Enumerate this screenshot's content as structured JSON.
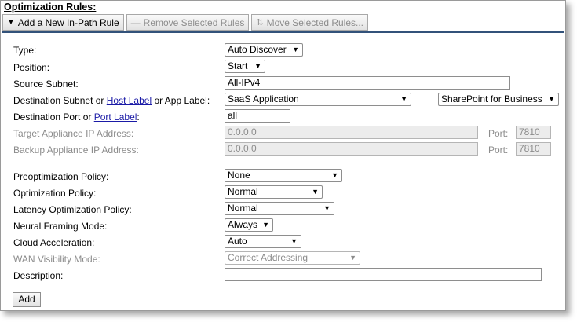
{
  "title": "Optimization Rules:",
  "toolbar": {
    "add_icon": "triangle-down-icon",
    "add_label": "Add a New In-Path Rule",
    "remove_icon": "minus-icon",
    "remove_label": "Remove Selected Rules",
    "move_icon": "move-arrows-icon",
    "move_label": "Move Selected Rules..."
  },
  "form": {
    "type_label": "Type:",
    "type_value": "Auto Discover",
    "position_label": "Position:",
    "position_value": "Start",
    "source_label": "Source Subnet:",
    "source_value": "All-IPv4",
    "dest_prefix": "Destination Subnet or ",
    "dest_link1": "Host Label",
    "dest_middle": " or App Label:",
    "dest_value": "SaaS Application",
    "dest_app_value": "SharePoint for Business",
    "port_prefix": "Destination Port or ",
    "port_link": "Port Label",
    "port_suffix": ":",
    "port_value": "all",
    "target_label": "Target Appliance IP Address:",
    "target_ip": "0.0.0.0",
    "target_port_label": "Port:",
    "target_port": "7810",
    "backup_label": "Backup Appliance IP Address:",
    "backup_ip": "0.0.0.0",
    "backup_port_label": "Port:",
    "backup_port": "7810",
    "preopt_label": "Preoptimization Policy:",
    "preopt_value": "None",
    "opt_label": "Optimization Policy:",
    "opt_value": "Normal",
    "latency_label": "Latency Optimization Policy:",
    "latency_value": "Normal",
    "neural_label": "Neural Framing Mode:",
    "neural_value": "Always",
    "cloud_label": "Cloud Acceleration:",
    "cloud_value": "Auto",
    "wan_label": "WAN Visibility Mode:",
    "wan_value": "Correct Addressing",
    "desc_label": "Description:",
    "desc_value": "",
    "add_button": "Add"
  },
  "colors": {
    "link": "#1a1aa6",
    "separator": "#32527a",
    "disabled_text": "#8c8c8c"
  }
}
